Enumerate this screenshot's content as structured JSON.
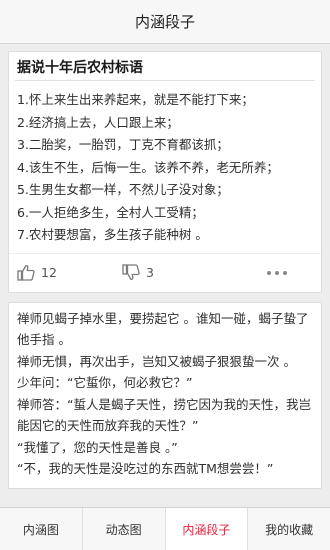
{
  "header": {
    "title": "内涵段子"
  },
  "posts": [
    {
      "title": "据说十年后农村标语",
      "lines": [
        "1.怀上来生出来养起来，就是不能打下来；",
        "2.经济搞上去，人口跟上来；",
        "3.二胎奖，一胎罚，丁克不育都该抓；",
        "4.该生不生，后悔一生。该养不养，老无所养；",
        "5.生男生女都一样，不然儿子没对象；",
        "6.一人拒绝多生，全村人工受精；",
        "7.农村要想富，多生孩子能种树 。"
      ],
      "likes": "12",
      "dislikes": "3"
    },
    {
      "lines": [
        "禅师见蝎子掉水里，要捞起它 。谁知一碰，蝎子蛰了他手指 。",
        "禅师无惧，再次出手，岂知又被蝎子狠狠蛰一次 。",
        "少年问：“它蜇你，何必救它？”",
        "禅师答：“蜇人是蝎子天性，捞它因为我的天性，我岂能因它的天性而放弃我的天性？”",
        "“我懂了，您的天性是善良 。”",
        "“不，我的天性是没吃过的东西就TM想尝尝！”"
      ]
    }
  ],
  "tabs": [
    {
      "label": "内涵图",
      "active": false
    },
    {
      "label": "动态图",
      "active": false
    },
    {
      "label": "内涵段子",
      "active": true
    },
    {
      "label": "我的收藏",
      "active": false
    }
  ],
  "colors": {
    "accent": "#e0233f",
    "background": "#ededed",
    "card": "#ffffff"
  }
}
